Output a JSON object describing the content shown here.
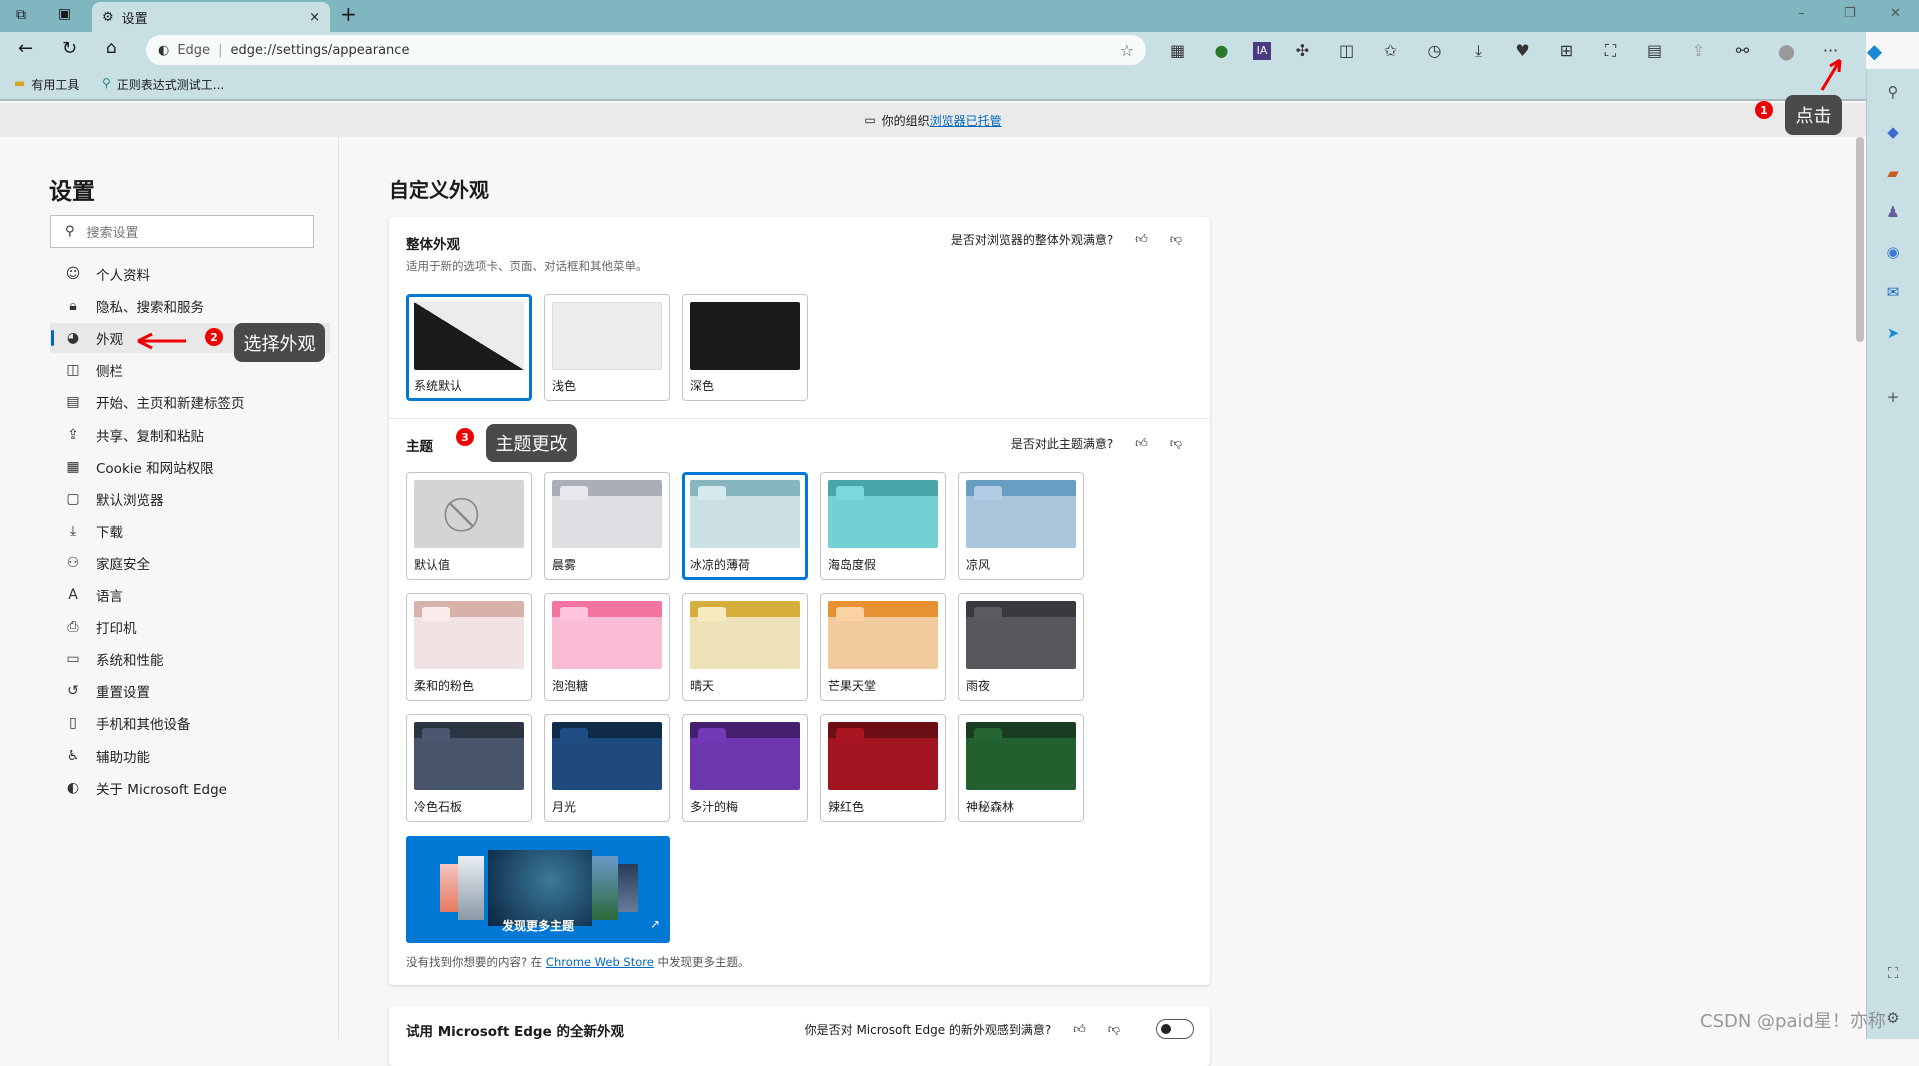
{
  "tab": {
    "title": "设置",
    "close": "×",
    "new_tab": "+"
  },
  "window_controls": {
    "minimize": "–",
    "restore": "❐",
    "close": "✕"
  },
  "address": {
    "site_label": "Edge",
    "url": "edge://settings/appearance"
  },
  "toolbar": {
    "more": "···"
  },
  "bookmarks": [
    {
      "label": "有用工具",
      "icon": "folder-icon"
    },
    {
      "label": "正则表达式测试工...",
      "icon": "search-icon"
    }
  ],
  "banner": {
    "text": "你的组织",
    "link": "浏览器已托管"
  },
  "sidebar": {
    "title": "设置",
    "search_placeholder": "搜索设置",
    "items": [
      {
        "label": "个人资料",
        "icon": "profile-icon"
      },
      {
        "label": "隐私、搜索和服务",
        "icon": "lock-icon"
      },
      {
        "label": "外观",
        "icon": "palette-icon",
        "active": true
      },
      {
        "label": "侧栏",
        "icon": "sidebar-icon"
      },
      {
        "label": "开始、主页和新建标签页",
        "icon": "home-page-icon"
      },
      {
        "label": "共享、复制和粘贴",
        "icon": "share-icon"
      },
      {
        "label": "Cookie 和网站权限",
        "icon": "cookie-icon"
      },
      {
        "label": "默认浏览器",
        "icon": "default-browser-icon"
      },
      {
        "label": "下载",
        "icon": "download-icon"
      },
      {
        "label": "家庭安全",
        "icon": "family-icon"
      },
      {
        "label": "语言",
        "icon": "language-icon"
      },
      {
        "label": "打印机",
        "icon": "printer-icon"
      },
      {
        "label": "系统和性能",
        "icon": "laptop-icon"
      },
      {
        "label": "重置设置",
        "icon": "reset-icon"
      },
      {
        "label": "手机和其他设备",
        "icon": "phone-icon"
      },
      {
        "label": "辅助功能",
        "icon": "accessibility-icon"
      },
      {
        "label": "关于 Microsoft Edge",
        "icon": "edge-icon"
      }
    ]
  },
  "main": {
    "title": "自定义外观",
    "overall": {
      "title": "整体外观",
      "subtitle": "适用于新的选项卡、页面、对话框和其他菜单。",
      "feedback": "是否对浏览器的整体外观满意?",
      "options": [
        {
          "label": "系统默认",
          "selected": true
        },
        {
          "label": "浅色"
        },
        {
          "label": "深色"
        }
      ]
    },
    "theme": {
      "title": "主题",
      "feedback": "是否对此主题满意?",
      "themes": [
        {
          "label": "默认值",
          "top": "#d4d4d4",
          "body": "#d4d4d4"
        },
        {
          "label": "晨雾",
          "top": "#aaaeb5",
          "body": "#dddfe2"
        },
        {
          "label": "冰凉的薄荷",
          "top": "#88b6bf",
          "body": "#cbe0e5",
          "selected": true
        },
        {
          "label": "海岛度假",
          "top": "#48a6a8",
          "body": "#74d1d3"
        },
        {
          "label": "凉风",
          "top": "#699dc2",
          "body": "#a9c5dc"
        },
        {
          "label": "柔和的粉色",
          "top": "#d7b2ab",
          "body": "#f1e3e3"
        },
        {
          "label": "泡泡糖",
          "top": "#f373a1",
          "body": "#f9bcd4"
        },
        {
          "label": "晴天",
          "top": "#d5ae3c",
          "body": "#ede1b8"
        },
        {
          "label": "芒果天堂",
          "top": "#e79132",
          "body": "#f1ca9e"
        },
        {
          "label": "雨夜",
          "top": "#393a3f",
          "body": "#57585e"
        },
        {
          "label": "冷色石板",
          "top": "#2b3441",
          "body": "#47546a"
        },
        {
          "label": "月光",
          "top": "#102a4a",
          "body": "#1e4a7e"
        },
        {
          "label": "多汁的梅",
          "top": "#45206e",
          "body": "#6e37b0"
        },
        {
          "label": "辣红色",
          "top": "#6b0f15",
          "body": "#a2141f"
        },
        {
          "label": "神秘森林",
          "top": "#1a3d21",
          "body": "#22602f"
        }
      ],
      "discover": "发现更多主题",
      "footer_prefix": "没有找到你想要的内容? 在 ",
      "footer_link": "Chrome Web Store",
      "footer_suffix": " 中发现更多主题。"
    },
    "new_look": {
      "title": "试用 Microsoft Edge 的全新外观",
      "feedback": "你是否对 Microsoft Edge 的新外观感到满意?",
      "enabled": false
    }
  },
  "annotations": [
    {
      "number": "1",
      "text": "点击"
    },
    {
      "number": "2",
      "text": "选择外观"
    },
    {
      "number": "3",
      "text": "主题更改"
    }
  ],
  "watermark": "CSDN @paid星！亦称",
  "colors": {
    "accent": "#0078d4",
    "annotation_red": "#e00000",
    "chrome": "#c8e0e4",
    "tabbar": "#7fb6bf"
  }
}
